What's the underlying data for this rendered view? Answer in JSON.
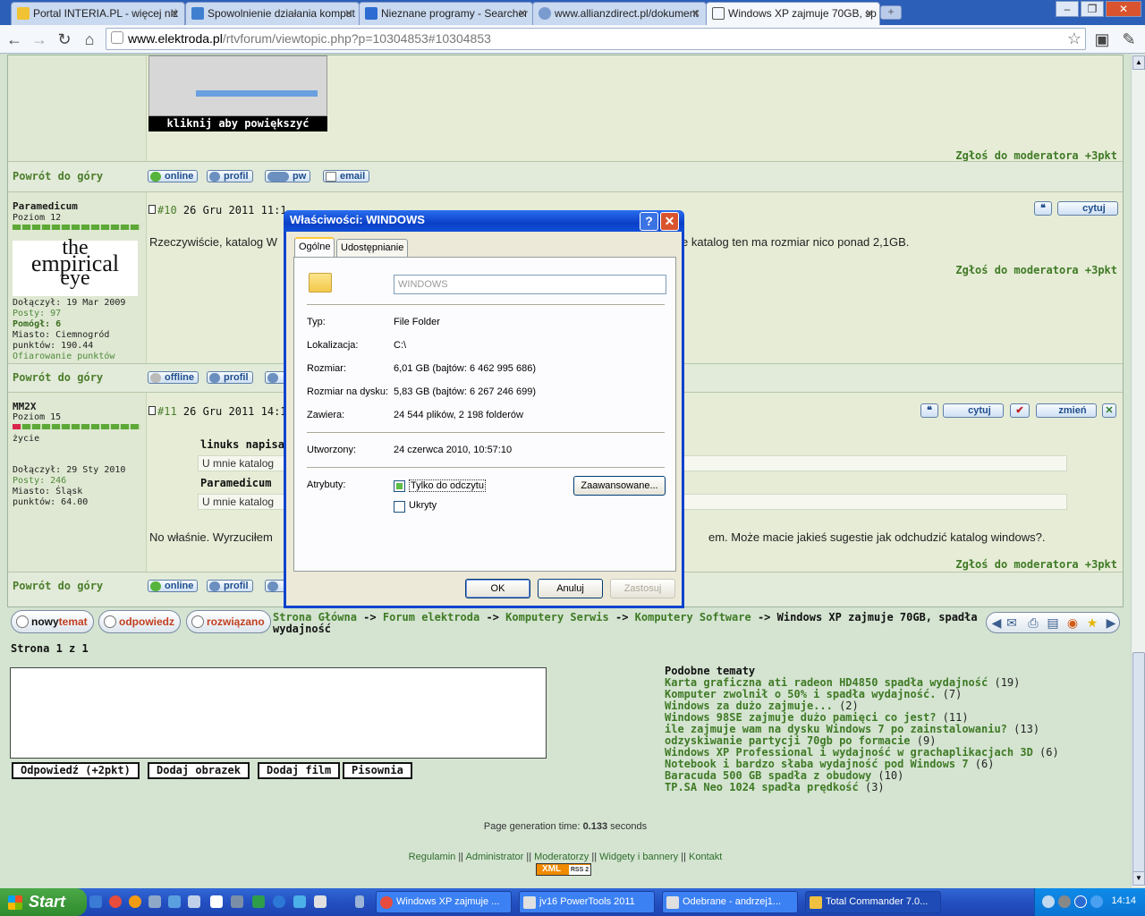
{
  "browser": {
    "tabs": [
      {
        "label": "Portal INTERIA.PL - więcej niż"
      },
      {
        "label": "Spowolnienie działania komput"
      },
      {
        "label": "Nieznane programy - Searcher"
      },
      {
        "label": "www.allianzdirect.pl/dokument"
      },
      {
        "label": "Windows XP zajmuje 70GB, sp"
      }
    ],
    "url_host": "www.elektroda.pl",
    "url_path": "/rtvforum/viewtopic.php?p=10304853#10304853"
  },
  "thumbnail": {
    "caption": "kliknij aby powiększyć"
  },
  "forum": {
    "report_link": "Zgłoś do moderatora +3pkt",
    "back_to_top": "Powrót do góry",
    "btn_profile": "profil",
    "btn_pw": "pw",
    "btn_email": "email",
    "btn_quote": "cytuj",
    "btn_edit": "zmień",
    "post1": {
      "status": "online"
    },
    "post2": {
      "user": "Paramedicum",
      "rank": "Poziom 12",
      "avatar_line1": "the",
      "avatar_line2": "empirical",
      "avatar_line3": "eye",
      "joined": "Dołączył: 19 Mar 2009",
      "posts": "Posty: 97",
      "helped": "Pomógł: 6",
      "city": "Miasto: Ciemnogród",
      "points": "punktów: 190.44",
      "donate": "Ofiarowanie punktów",
      "num": "#10",
      "date": "26 Gru 2011 11:1",
      "text_left": "Rzeczywiście, katalog W",
      "text_right": "e katalog ten ma rozmiar nico ponad 2,1GB.",
      "status": "offline"
    },
    "post3": {
      "user": "MM2X",
      "rank": "Poziom 15",
      "life": "życie",
      "joined": "Dołączył: 29 Sty 2010",
      "posts": "Posty: 246",
      "city": "Miasto: Śląsk",
      "points": "punktów: 64.00",
      "num": "#11",
      "date": "26 Gru 2011 14:1",
      "quote1_head": "linuks napisał:",
      "quote1_text": "U mnie katalog",
      "quote2_head": "Paramedicum",
      "quote2_text": "U mnie katalog",
      "text_left": "No właśnie. Wyrzuciłem",
      "text_right": "em. Może macie jakieś sugestie jak odchudzić katalog windows?.",
      "status": "online"
    }
  },
  "actions": {
    "new_topic_a": "nowy",
    "new_topic_b": "temat",
    "reply": "odpowiedz",
    "solved": "rozwiązano"
  },
  "breadcrumb": {
    "items": [
      "Strona Główna",
      "Forum elektroda",
      "Komputery Serwis",
      "Komputery Software"
    ],
    "separator": "->",
    "current": "Windows XP zajmuje 70GB, spadła wydajność"
  },
  "pagination": "Strona 1 z 1",
  "reply_buttons": [
    "Odpowiedź (+2pkt)",
    "Dodaj obrazek",
    "Dodaj film",
    "Pisownia"
  ],
  "similar": {
    "title": "Podobne tematy",
    "items": [
      {
        "title": "Karta graficzna ati radeon HD4850 spadła wydajność",
        "count": "(19)"
      },
      {
        "title": "Komputer zwolnił o 50% i spadła wydajność.",
        "count": "(7)"
      },
      {
        "title": "Windows za dużo zajmuje...",
        "count": "(2)"
      },
      {
        "title": "Windows 98SE zajmuje dużo pamięci co jest?",
        "count": "(11)"
      },
      {
        "title": "ile zajmuje wam na dysku Windows 7 po zainstalowaniu?",
        "count": "(13)"
      },
      {
        "title": "odzyskiwanie partycji 70gb po formacie",
        "count": "(9)"
      },
      {
        "title": "Windows XP Professional i wydajność w grachaplikacjach 3D",
        "count": "(6)"
      },
      {
        "title": "Notebook i bardzo słaba wydajność pod Windows 7",
        "count": "(6)"
      },
      {
        "title": "Baracuda 500 GB spadła z obudowy",
        "count": "(10)"
      },
      {
        "title": "TP.SA Neo 1024 spadła prędkość",
        "count": "(3)"
      }
    ]
  },
  "footer": {
    "gen_prefix": "Page generation time:",
    "gen_value": "0.133",
    "gen_suffix": "seconds",
    "links": [
      "Regulamin",
      "Administrator",
      "Moderatorzy",
      "Widgety i bannery",
      "Kontakt"
    ],
    "link_sep": "||",
    "xml": "XML",
    "rss": "RSS 2"
  },
  "dialog": {
    "title": "Właściwości: WINDOWS",
    "help": "?",
    "close": "✕",
    "tabs": [
      "Ogólne",
      "Udostępnianie"
    ],
    "name": "WINDOWS",
    "rows": [
      {
        "label": "Typ:",
        "value": "File Folder"
      },
      {
        "label": "Lokalizacja:",
        "value": "C:\\"
      },
      {
        "label": "Rozmiar:",
        "value": "6,01 GB (bajtów: 6 462 995 686)"
      },
      {
        "label": "Rozmiar na dysku:",
        "value": "5,83 GB (bajtów: 6 267 246 699)"
      },
      {
        "label": "Zawiera:",
        "value": "24 544 plików, 2 198 folderów"
      }
    ],
    "created_label": "Utworzony:",
    "created_value": "24 czerwca 2010, 10:57:10",
    "attributes_label": "Atrybuty:",
    "readonly": "Tylko do odczytu",
    "hidden": "Ukryty",
    "advanced": "Zaawansowane...",
    "ok": "OK",
    "cancel": "Anuluj",
    "apply": "Zastosuj"
  },
  "taskbar": {
    "start": "Start",
    "tasks": [
      "Windows XP zajmuje ...",
      "jv16 PowerTools 2011",
      "Odebrane - andrzej1...",
      "Total Commander 7.0..."
    ],
    "clock": "14:14"
  }
}
